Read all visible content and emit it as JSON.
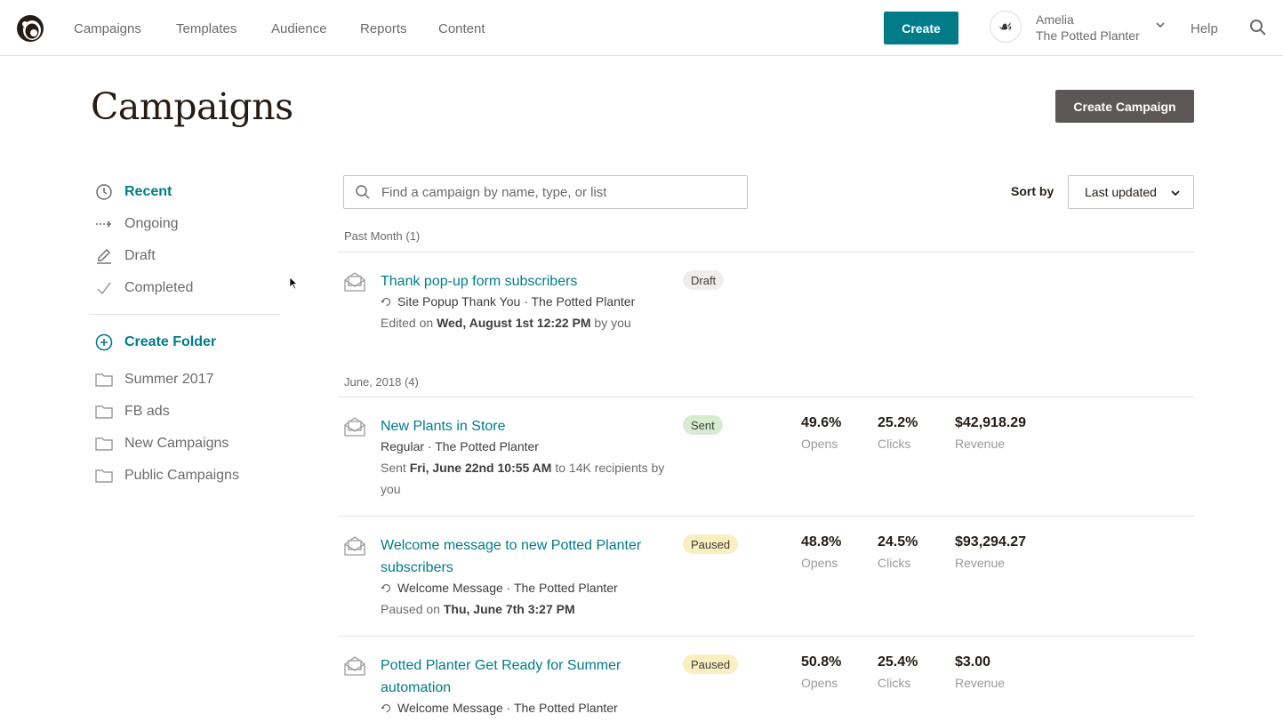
{
  "nav": {
    "items": [
      {
        "label": "Campaigns",
        "active": true
      },
      {
        "label": "Templates",
        "active": false
      },
      {
        "label": "Audience",
        "active": false
      },
      {
        "label": "Reports",
        "active": false
      },
      {
        "label": "Content",
        "active": false
      }
    ],
    "create_label": "Create",
    "account": {
      "name": "Amelia",
      "org": "The Potted Planter",
      "avatar_icon": "monogram-icon"
    },
    "help_label": "Help",
    "search_icon": "search-icon"
  },
  "page": {
    "title": "Campaigns",
    "create_campaign_label": "Create Campaign"
  },
  "sidebar": {
    "filters": [
      {
        "label": "Recent",
        "icon": "clock-icon",
        "active": true
      },
      {
        "label": "Ongoing",
        "icon": "dashed-arrow-icon",
        "active": false
      },
      {
        "label": "Draft",
        "icon": "pencil-icon",
        "active": false
      },
      {
        "label": "Completed",
        "icon": "checkmark-icon",
        "active": false
      }
    ],
    "create_folder_label": "Create Folder",
    "folders": [
      {
        "label": "Summer 2017"
      },
      {
        "label": "FB ads"
      },
      {
        "label": "New Campaigns"
      },
      {
        "label": "Public Campaigns"
      }
    ]
  },
  "search": {
    "placeholder": "Find a campaign by name, type, or list",
    "value": ""
  },
  "sort": {
    "label": "Sort by",
    "selected": "Last updated"
  },
  "groups": [
    {
      "heading": "Past Month (1)",
      "campaigns": [
        {
          "title": "Thank pop-up form subscribers",
          "subtitle": "Site Popup Thank You · The Potted Planter",
          "meta_prefix": "Edited on ",
          "meta_bold": "Wed, August 1st 12:22 PM",
          "meta_suffix": " by you",
          "status": "Draft"
        }
      ]
    },
    {
      "heading": "June, 2018 (4)",
      "campaigns": [
        {
          "title": "New Plants in Store",
          "subtitle": "Regular · The Potted Planter",
          "meta_prefix": "Sent ",
          "meta_bold": "Fri, June 22nd 10:55 AM",
          "meta_suffix": " to 14K recipients by you",
          "status": "Sent",
          "opens": "49.6%",
          "opens_label": "Opens",
          "clicks": "25.2%",
          "clicks_label": "Clicks",
          "revenue": "$42,918.29",
          "revenue_label": "Revenue"
        },
        {
          "title": "Welcome message to new Potted Planter subscribers",
          "subtitle": "Welcome Message · The Potted Planter",
          "meta_prefix": "Paused on ",
          "meta_bold": "Thu, June 7th 3:27 PM",
          "meta_suffix": "",
          "status": "Paused",
          "opens": "48.8%",
          "opens_label": "Opens",
          "clicks": "24.5%",
          "clicks_label": "Clicks",
          "revenue": "$93,294.27",
          "revenue_label": "Revenue"
        },
        {
          "title": "Potted Planter Get Ready for Summer automation",
          "subtitle": "Welcome Message · The Potted Planter",
          "status": "Paused",
          "opens": "50.8%",
          "opens_label": "Opens",
          "clicks": "25.4%",
          "clicks_label": "Clicks",
          "revenue": "$3.00",
          "revenue_label": "Revenue"
        }
      ]
    }
  ],
  "colors": {
    "accent": "#007c89",
    "create_campaign_bg": "#5d5757",
    "draft_badge": "#efeeea",
    "sent_badge": "#d5ecd1",
    "paused_badge": "#fbeec0"
  }
}
